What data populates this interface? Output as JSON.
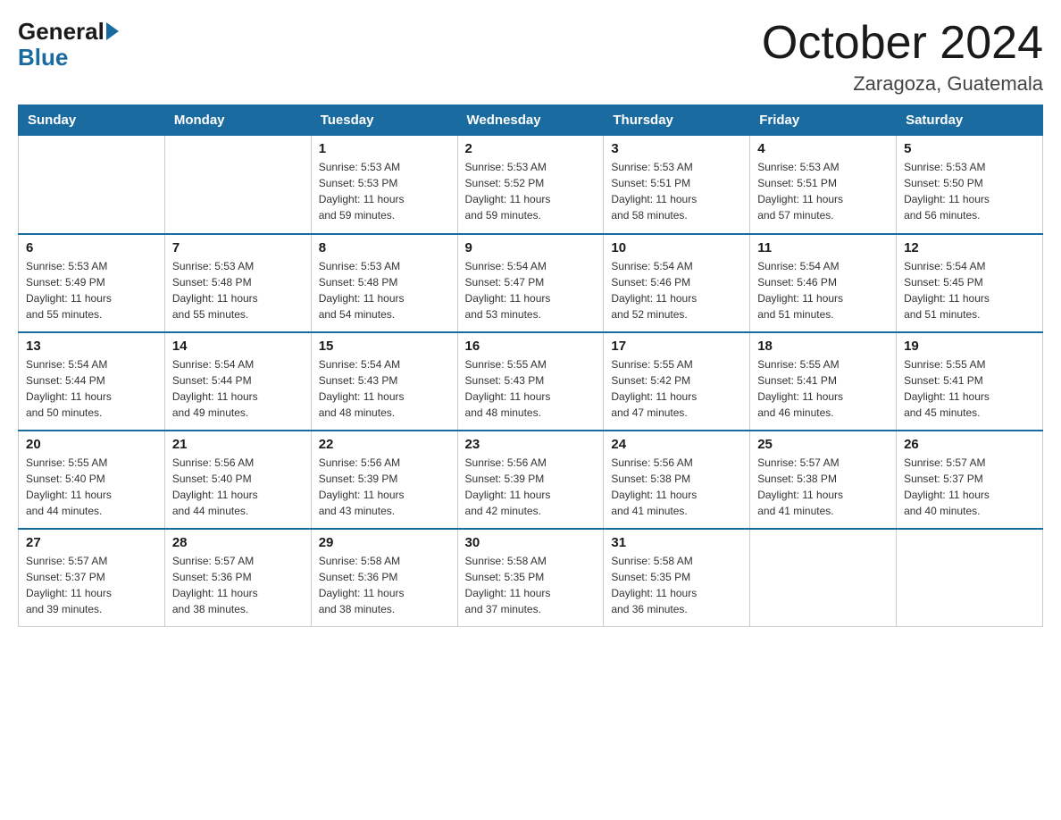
{
  "header": {
    "logo_general": "General",
    "logo_blue": "Blue",
    "month_year": "October 2024",
    "location": "Zaragoza, Guatemala"
  },
  "weekdays": [
    "Sunday",
    "Monday",
    "Tuesday",
    "Wednesday",
    "Thursday",
    "Friday",
    "Saturday"
  ],
  "rows": [
    [
      {
        "day": "",
        "info": ""
      },
      {
        "day": "",
        "info": ""
      },
      {
        "day": "1",
        "info": "Sunrise: 5:53 AM\nSunset: 5:53 PM\nDaylight: 11 hours\nand 59 minutes."
      },
      {
        "day": "2",
        "info": "Sunrise: 5:53 AM\nSunset: 5:52 PM\nDaylight: 11 hours\nand 59 minutes."
      },
      {
        "day": "3",
        "info": "Sunrise: 5:53 AM\nSunset: 5:51 PM\nDaylight: 11 hours\nand 58 minutes."
      },
      {
        "day": "4",
        "info": "Sunrise: 5:53 AM\nSunset: 5:51 PM\nDaylight: 11 hours\nand 57 minutes."
      },
      {
        "day": "5",
        "info": "Sunrise: 5:53 AM\nSunset: 5:50 PM\nDaylight: 11 hours\nand 56 minutes."
      }
    ],
    [
      {
        "day": "6",
        "info": "Sunrise: 5:53 AM\nSunset: 5:49 PM\nDaylight: 11 hours\nand 55 minutes."
      },
      {
        "day": "7",
        "info": "Sunrise: 5:53 AM\nSunset: 5:48 PM\nDaylight: 11 hours\nand 55 minutes."
      },
      {
        "day": "8",
        "info": "Sunrise: 5:53 AM\nSunset: 5:48 PM\nDaylight: 11 hours\nand 54 minutes."
      },
      {
        "day": "9",
        "info": "Sunrise: 5:54 AM\nSunset: 5:47 PM\nDaylight: 11 hours\nand 53 minutes."
      },
      {
        "day": "10",
        "info": "Sunrise: 5:54 AM\nSunset: 5:46 PM\nDaylight: 11 hours\nand 52 minutes."
      },
      {
        "day": "11",
        "info": "Sunrise: 5:54 AM\nSunset: 5:46 PM\nDaylight: 11 hours\nand 51 minutes."
      },
      {
        "day": "12",
        "info": "Sunrise: 5:54 AM\nSunset: 5:45 PM\nDaylight: 11 hours\nand 51 minutes."
      }
    ],
    [
      {
        "day": "13",
        "info": "Sunrise: 5:54 AM\nSunset: 5:44 PM\nDaylight: 11 hours\nand 50 minutes."
      },
      {
        "day": "14",
        "info": "Sunrise: 5:54 AM\nSunset: 5:44 PM\nDaylight: 11 hours\nand 49 minutes."
      },
      {
        "day": "15",
        "info": "Sunrise: 5:54 AM\nSunset: 5:43 PM\nDaylight: 11 hours\nand 48 minutes."
      },
      {
        "day": "16",
        "info": "Sunrise: 5:55 AM\nSunset: 5:43 PM\nDaylight: 11 hours\nand 48 minutes."
      },
      {
        "day": "17",
        "info": "Sunrise: 5:55 AM\nSunset: 5:42 PM\nDaylight: 11 hours\nand 47 minutes."
      },
      {
        "day": "18",
        "info": "Sunrise: 5:55 AM\nSunset: 5:41 PM\nDaylight: 11 hours\nand 46 minutes."
      },
      {
        "day": "19",
        "info": "Sunrise: 5:55 AM\nSunset: 5:41 PM\nDaylight: 11 hours\nand 45 minutes."
      }
    ],
    [
      {
        "day": "20",
        "info": "Sunrise: 5:55 AM\nSunset: 5:40 PM\nDaylight: 11 hours\nand 44 minutes."
      },
      {
        "day": "21",
        "info": "Sunrise: 5:56 AM\nSunset: 5:40 PM\nDaylight: 11 hours\nand 44 minutes."
      },
      {
        "day": "22",
        "info": "Sunrise: 5:56 AM\nSunset: 5:39 PM\nDaylight: 11 hours\nand 43 minutes."
      },
      {
        "day": "23",
        "info": "Sunrise: 5:56 AM\nSunset: 5:39 PM\nDaylight: 11 hours\nand 42 minutes."
      },
      {
        "day": "24",
        "info": "Sunrise: 5:56 AM\nSunset: 5:38 PM\nDaylight: 11 hours\nand 41 minutes."
      },
      {
        "day": "25",
        "info": "Sunrise: 5:57 AM\nSunset: 5:38 PM\nDaylight: 11 hours\nand 41 minutes."
      },
      {
        "day": "26",
        "info": "Sunrise: 5:57 AM\nSunset: 5:37 PM\nDaylight: 11 hours\nand 40 minutes."
      }
    ],
    [
      {
        "day": "27",
        "info": "Sunrise: 5:57 AM\nSunset: 5:37 PM\nDaylight: 11 hours\nand 39 minutes."
      },
      {
        "day": "28",
        "info": "Sunrise: 5:57 AM\nSunset: 5:36 PM\nDaylight: 11 hours\nand 38 minutes."
      },
      {
        "day": "29",
        "info": "Sunrise: 5:58 AM\nSunset: 5:36 PM\nDaylight: 11 hours\nand 38 minutes."
      },
      {
        "day": "30",
        "info": "Sunrise: 5:58 AM\nSunset: 5:35 PM\nDaylight: 11 hours\nand 37 minutes."
      },
      {
        "day": "31",
        "info": "Sunrise: 5:58 AM\nSunset: 5:35 PM\nDaylight: 11 hours\nand 36 minutes."
      },
      {
        "day": "",
        "info": ""
      },
      {
        "day": "",
        "info": ""
      }
    ]
  ]
}
